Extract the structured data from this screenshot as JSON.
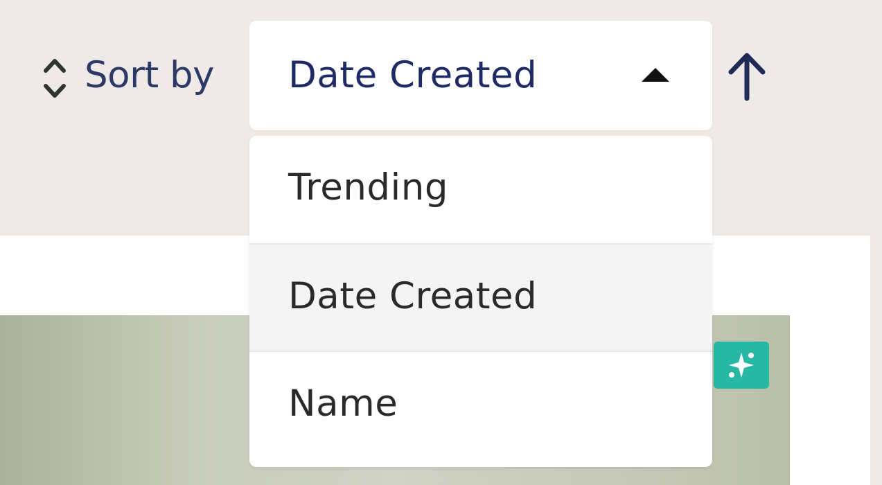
{
  "sort": {
    "label": "Sort by",
    "selected_value": "Date Created",
    "order_icon": "arrow-up-icon",
    "options": [
      {
        "label": "Trending"
      },
      {
        "label": "Date Created",
        "highlighted": true
      },
      {
        "label": "Name"
      }
    ]
  },
  "icons": {
    "sort": "sort-icon",
    "caret": "caret-up-icon",
    "ai_badge": "sparkle-icon"
  },
  "colors": {
    "toolbar_bg": "#efeae7",
    "label_text": "#2e3a66",
    "arrow_accent": "#c9842e",
    "badge": "#26b8a2"
  }
}
